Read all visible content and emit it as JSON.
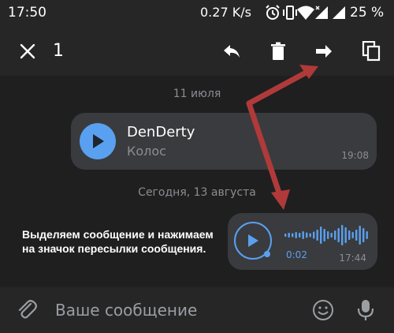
{
  "status_bar": {
    "time": "17:50",
    "network_speed": "0.27 K/s",
    "battery": "25 %"
  },
  "selection_bar": {
    "selected_count": "1",
    "icons": [
      "close-icon",
      "reply-icon",
      "delete-icon",
      "forward-icon",
      "copy-icon"
    ]
  },
  "chat": {
    "date_1": "11 июля",
    "message_1": {
      "author": "DenDerty",
      "title": "Колос",
      "time": "19:08"
    },
    "date_2": "Сегодня, 13 августа",
    "message_2": {
      "duration": "0:02",
      "time": "17:44"
    }
  },
  "annotation": {
    "text": "Выделяем сообщение и нажимаем на значок пересылки сообщения.",
    "arrow_color": "#b03a3a"
  },
  "input_bar": {
    "placeholder": "Ваше сообщение"
  },
  "colors": {
    "background": "#1f1f20",
    "bars": "#262626",
    "bubble": "#3a3b3e",
    "accent": "#5aa0f0"
  }
}
